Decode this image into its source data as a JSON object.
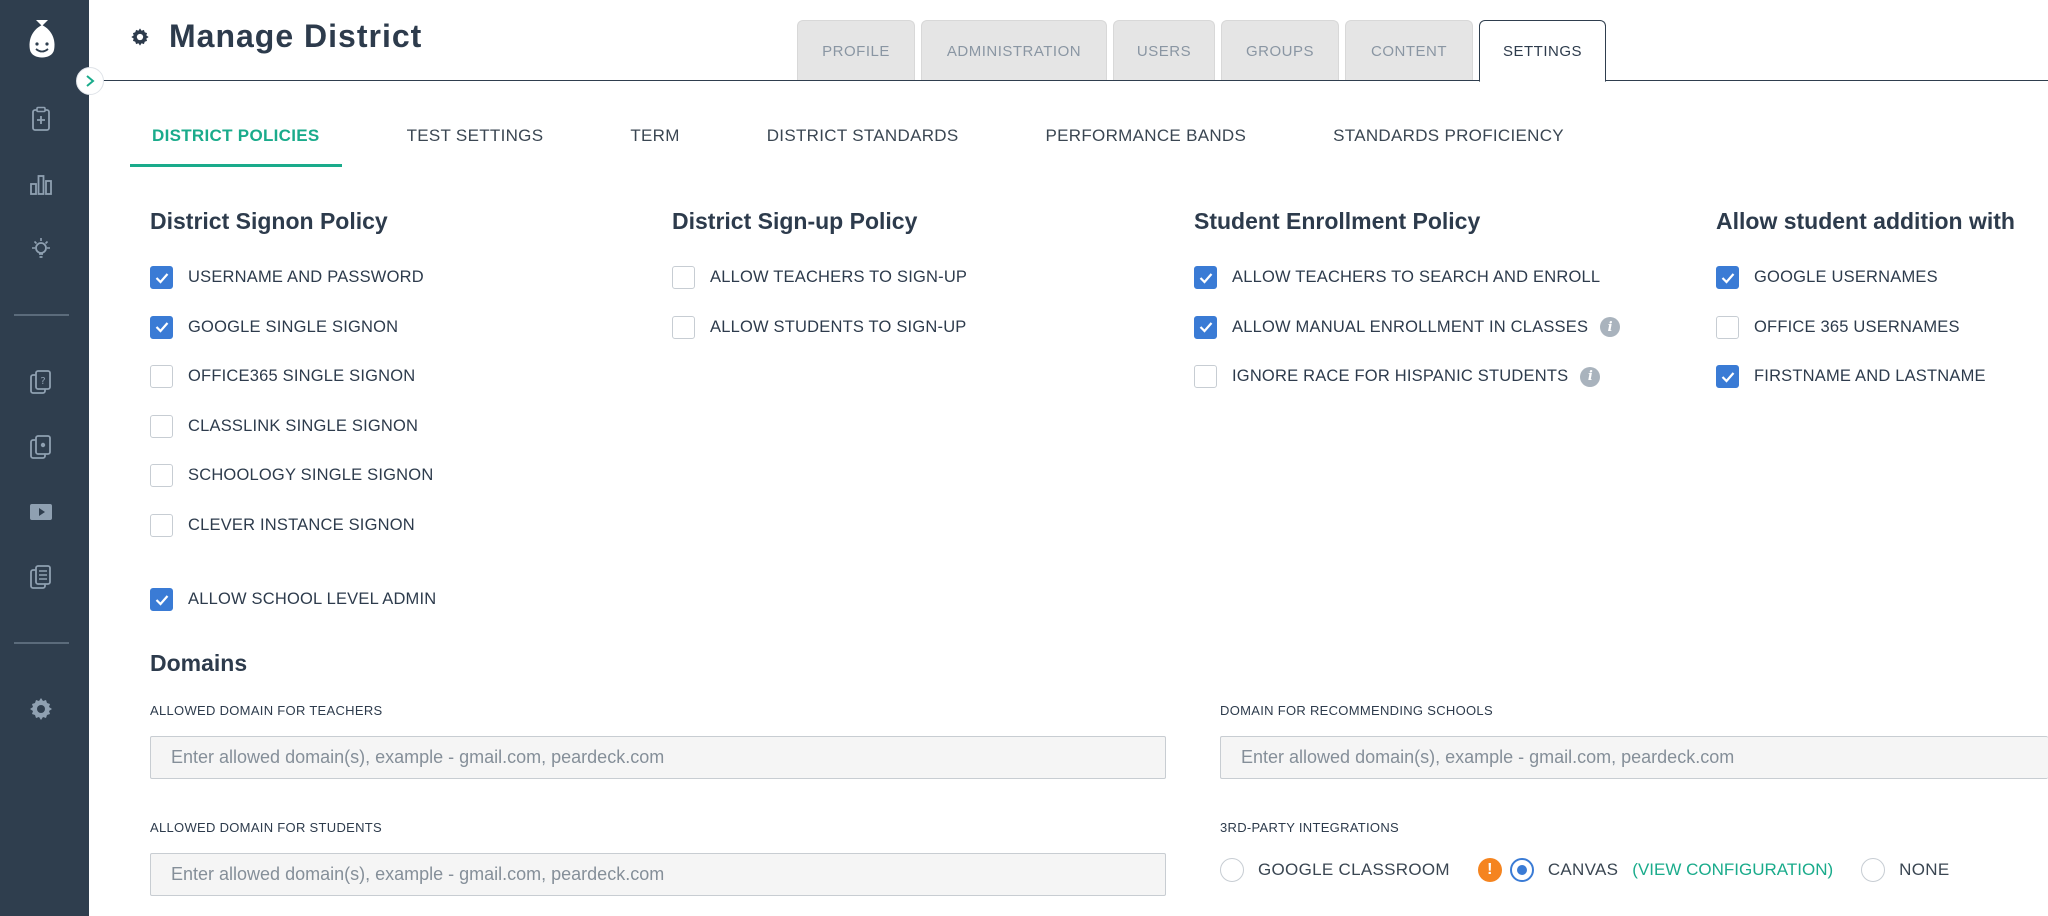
{
  "header": {
    "title": "Manage District"
  },
  "top_tabs": [
    "PROFILE",
    "ADMINISTRATION",
    "USERS",
    "GROUPS",
    "CONTENT",
    "SETTINGS"
  ],
  "active_top_tab": "SETTINGS",
  "sub_tabs": [
    "DISTRICT POLICIES",
    "TEST SETTINGS",
    "TERM",
    "DISTRICT STANDARDS",
    "PERFORMANCE BANDS",
    "STANDARDS PROFICIENCY"
  ],
  "active_sub_tab": "DISTRICT POLICIES",
  "signon": {
    "title": "District Signon Policy",
    "options": [
      {
        "label": "USERNAME AND PASSWORD",
        "checked": true
      },
      {
        "label": "GOOGLE SINGLE SIGNON",
        "checked": true
      },
      {
        "label": "OFFICE365 SINGLE SIGNON",
        "checked": false
      },
      {
        "label": "CLASSLINK SINGLE SIGNON",
        "checked": false
      },
      {
        "label": "SCHOOLOGY SINGLE SIGNON",
        "checked": false
      },
      {
        "label": "CLEVER INSTANCE SIGNON",
        "checked": false
      }
    ]
  },
  "signup": {
    "title": "District Sign-up Policy",
    "options": [
      {
        "label": "ALLOW TEACHERS TO SIGN-UP",
        "checked": false
      },
      {
        "label": "ALLOW STUDENTS TO SIGN-UP",
        "checked": false
      }
    ]
  },
  "enrollment": {
    "title": "Student Enrollment Policy",
    "options": [
      {
        "label": "ALLOW TEACHERS TO SEARCH AND ENROLL",
        "checked": true
      },
      {
        "label": "ALLOW MANUAL ENROLLMENT IN CLASSES",
        "checked": true
      },
      {
        "label": "IGNORE RACE FOR HISPANIC STUDENTS",
        "checked": false
      }
    ],
    "info_icon": "i"
  },
  "addition": {
    "title": "Allow student addition with",
    "options": [
      {
        "label": "GOOGLE USERNAMES",
        "checked": true
      },
      {
        "label": "OFFICE 365 USERNAMES",
        "checked": false
      },
      {
        "label": "FIRSTNAME AND LASTNAME",
        "checked": true
      }
    ]
  },
  "school_admin": {
    "label": "ALLOW SCHOOL LEVEL ADMIN",
    "checked": true
  },
  "domains": {
    "title": "Domains",
    "teachers_label": "ALLOWED DOMAIN FOR TEACHERS",
    "students_label": "ALLOWED DOMAIN FOR STUDENTS",
    "recommending_label": "DOMAIN FOR RECOMMENDING SCHOOLS",
    "placeholder": "Enter allowed domain(s), example - gmail.com, peardeck.com"
  },
  "integrations": {
    "label": "3RD-PARTY INTEGRATIONS",
    "google": "GOOGLE CLASSROOM",
    "canvas": "CANVAS",
    "view_config": "(VIEW CONFIGURATION)",
    "none": "NONE",
    "warning_glyph": "!",
    "selected": "CANVAS"
  },
  "colors": {
    "sidebar": "#2f3e4e",
    "accent_green": "#1aab8b",
    "checkbox_blue": "#3a7bd5",
    "warning_orange": "#f5841f"
  },
  "sidebar_icons": [
    "logo-icon",
    "assignment-icon",
    "reports-icon",
    "lightbulb-icon",
    "question-bank-icon",
    "test-library-icon",
    "video-icon",
    "playlist-icon",
    "settings-icon"
  ]
}
